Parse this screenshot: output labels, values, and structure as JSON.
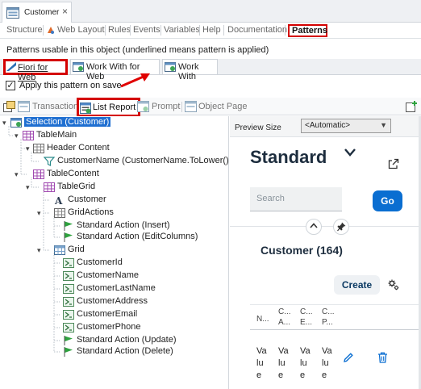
{
  "window": {
    "doc_tab": "Customer",
    "close_glyph": "×"
  },
  "object_tabs": [
    "Structure",
    "Web Layout",
    "Rules",
    "Events",
    "Variables",
    "Help",
    "Documentation",
    "Patterns"
  ],
  "hint_text": "Patterns usable in this object (underlined means pattern is applied)",
  "pattern_tabs": [
    "Fiori for Web",
    "Work With for Web",
    "Work With"
  ],
  "apply_checkbox": {
    "label": "Apply this pattern on save",
    "checked": true,
    "check_glyph": "✓"
  },
  "pattern_toolbar": [
    "Transaction",
    "List Report",
    "Prompt",
    "Object Page"
  ],
  "tree": {
    "nodes": [
      "Selection (Customer)",
      "TableMain",
      "Header Content",
      "CustomerName (CustomerName.ToLower() li",
      "TableContent",
      "TableGrid",
      "Customer",
      "GridActions",
      "Standard Action (Insert)",
      "Standard Action (EditColumns)",
      "Grid",
      "CustomerId",
      "CustomerName",
      "CustomerLastName",
      "CustomerAddress",
      "CustomerEmail",
      "CustomerPhone",
      "Standard Action (Update)",
      "Standard Action (Delete)"
    ]
  },
  "preview": {
    "size_label": "Preview Size",
    "size_value": "<Automatic>",
    "title": "Standard",
    "search_placeholder": "Search",
    "go_label": "Go",
    "table_title": "Customer (164)",
    "create_label": "Create",
    "columns": [
      {
        "lines": [
          "N..."
        ]
      },
      {
        "lines": [
          "C...",
          "A..."
        ]
      },
      {
        "lines": [
          "C...",
          "E..."
        ]
      },
      {
        "lines": [
          "C...",
          "P..."
        ]
      }
    ],
    "cell_value": "Value"
  },
  "icons": {
    "title_chevron": "chevron-down-icon",
    "share": "share-icon",
    "collapse": "chevron-up-icon",
    "pin": "pin-icon",
    "settings": "gear-icon",
    "edit": "pencil-icon",
    "delete": "trash-icon"
  },
  "colors": {
    "highlight": "#d40000",
    "selection": "#1f6fd1",
    "fiori_go": "#0a6ed1",
    "fiori_title": "#1d2d3e"
  }
}
